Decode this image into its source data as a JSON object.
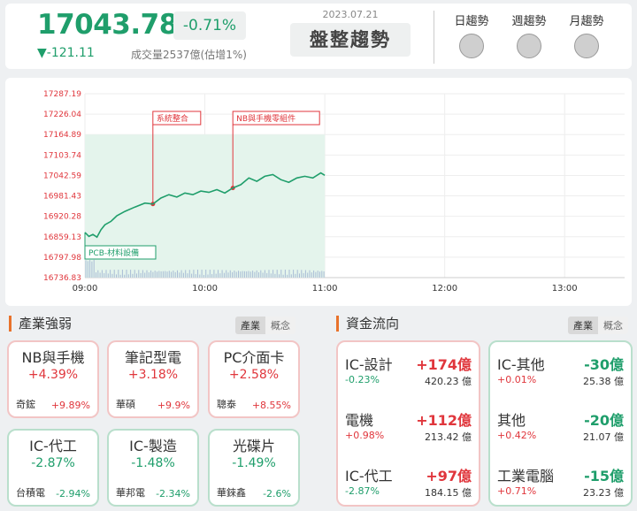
{
  "index": {
    "price": "17043.78",
    "pct_change": "-0.71%",
    "change": "▼-121.11",
    "volume": "成交量2537億(估增1%)",
    "date": "2023.07.21",
    "trend_label": "盤整趨勢"
  },
  "trends": [
    {
      "label": "日趨勢"
    },
    {
      "label": "週趨勢"
    },
    {
      "label": "月趨勢"
    }
  ],
  "chart_data": {
    "type": "line",
    "y_ticks": [
      "17287.19",
      "17226.04",
      "17164.89",
      "17103.74",
      "17042.59",
      "16981.43",
      "16920.28",
      "16859.13",
      "16797.98",
      "16736.83"
    ],
    "x_ticks": [
      "09:00",
      "10:00",
      "11:00",
      "12:00",
      "13:00"
    ],
    "ylim": [
      16736.83,
      17287.19
    ],
    "x_range": [
      "09:00",
      "13:30"
    ],
    "reference_price": 17164.89,
    "series": [
      {
        "x": [
          "09:00",
          "09:02",
          "09:04",
          "09:06",
          "09:08",
          "09:10",
          "09:13",
          "09:16",
          "09:20",
          "09:25",
          "09:30",
          "09:34",
          "09:38",
          "09:42",
          "09:46",
          "09:50",
          "09:54",
          "09:58",
          "10:02",
          "10:06",
          "10:10",
          "10:14",
          "10:18",
          "10:22",
          "10:26",
          "10:30",
          "10:34",
          "10:38",
          "10:42",
          "10:46",
          "10:50",
          "10:54",
          "10:58",
          "11:00"
        ],
        "values": [
          16872,
          16860,
          16866,
          16858,
          16880,
          16895,
          16905,
          16922,
          16935,
          16948,
          16960,
          16957,
          16975,
          16985,
          16978,
          16990,
          16985,
          16996,
          16992,
          17000,
          16990,
          17005,
          17015,
          17035,
          17025,
          17040,
          17045,
          17030,
          17022,
          17035,
          17040,
          17035,
          17050,
          17043
        ]
      }
    ],
    "annotations": [
      {
        "time": "09:34",
        "label": "系統整合"
      },
      {
        "time": "10:14",
        "label": "NB與手機零組件"
      },
      {
        "time": "09:00",
        "label": "PCB-材料設備"
      }
    ]
  },
  "industry": {
    "title": "產業強弱",
    "tabs": [
      "產業",
      "概念"
    ],
    "cards": [
      {
        "name": "NB與手機",
        "pct": "+4.39%",
        "stock": "奇鋐",
        "stock_pct": "+9.89%",
        "tone": "up"
      },
      {
        "name": "筆記型電",
        "pct": "+3.18%",
        "stock": "華碩",
        "stock_pct": "+9.9%",
        "tone": "up"
      },
      {
        "name": "PC介面卡",
        "pct": "+2.58%",
        "stock": "聰泰",
        "stock_pct": "+8.55%",
        "tone": "up"
      },
      {
        "name": "IC-代工",
        "pct": "-2.87%",
        "stock": "台積電",
        "stock_pct": "-2.94%",
        "tone": "dn"
      },
      {
        "name": "IC-製造",
        "pct": "-1.48%",
        "stock": "華邦電",
        "stock_pct": "-2.34%",
        "tone": "dn"
      },
      {
        "name": "光碟片",
        "pct": "-1.49%",
        "stock": "華錸鑫",
        "stock_pct": "-2.6%",
        "tone": "dn"
      }
    ]
  },
  "fund_flow": {
    "title": "資金流向",
    "tabs": [
      "產業",
      "概念"
    ],
    "inflow": [
      {
        "name": "IC-設計",
        "amount": "+174億",
        "pct": "-0.23%",
        "value": "420.23 億",
        "pct_tone": "dn"
      },
      {
        "name": "電機",
        "amount": "+112億",
        "pct": "+0.98%",
        "value": "213.42 億",
        "pct_tone": "up"
      },
      {
        "name": "IC-代工",
        "amount": "+97億",
        "pct": "-2.87%",
        "value": "184.15 億",
        "pct_tone": "dn"
      }
    ],
    "outflow": [
      {
        "name": "IC-其他",
        "amount": "-30億",
        "pct": "+0.01%",
        "value": "25.38 億",
        "pct_tone": "up"
      },
      {
        "name": "其他",
        "amount": "-20億",
        "pct": "+0.42%",
        "value": "21.07 億",
        "pct_tone": "up"
      },
      {
        "name": "工業電腦",
        "amount": "-15億",
        "pct": "+0.71%",
        "value": "23.23 億",
        "pct_tone": "up"
      }
    ]
  },
  "colors": {
    "up": "#e0363c",
    "down": "#1f9e6b",
    "accent": "#e8722b"
  }
}
